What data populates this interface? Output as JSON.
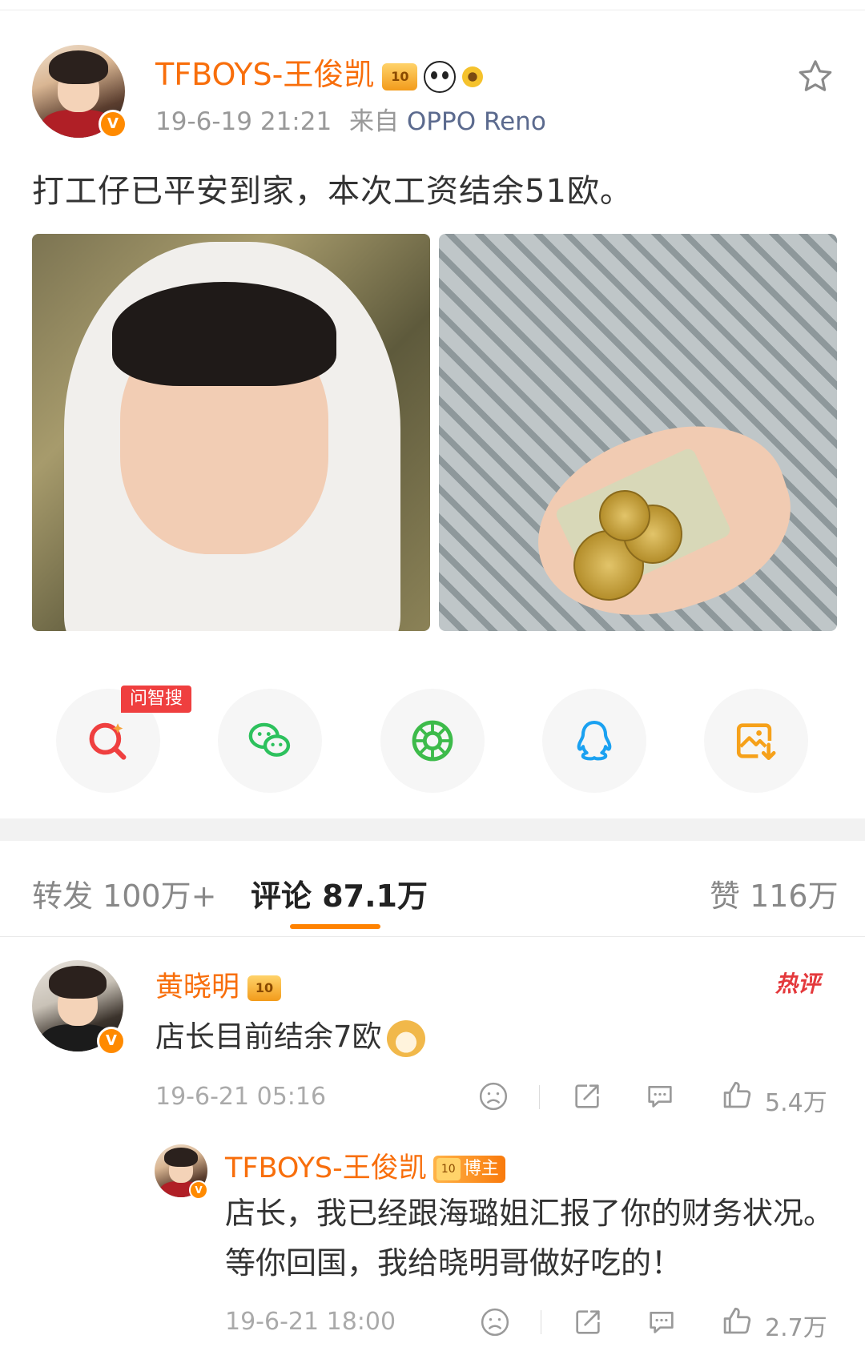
{
  "post": {
    "author": "TFBOYS-王俊凯",
    "crown_badge": "10",
    "timestamp": "19-6-19 21:21",
    "source_prefix": "来自",
    "source_device": "OPPO Reno",
    "text": "打工仔已平安到家，本次工资结余51欧。",
    "verified_mark": "V"
  },
  "share": {
    "tag_label": "问智搜",
    "buttons": [
      "search-ai",
      "wechat",
      "moments",
      "qq",
      "save-image"
    ]
  },
  "tabs": {
    "repost": "转发 100万+",
    "comment": "评论 87.1万",
    "like": "赞 116万"
  },
  "comments": [
    {
      "author": "黄晓明",
      "text": "店长目前结余7欧",
      "time": "19-6-21 05:16",
      "likes": "5.4万",
      "hot_label": "热评",
      "crown_badge": "10",
      "reply": {
        "author": "TFBOYS-王俊凯",
        "badge": "博主",
        "crown_badge": "10",
        "text": "店长，我已经跟海璐姐汇报了你的财务状况。等你回国，我给晓明哥做好吃的！",
        "time": "19-6-21 18:00",
        "likes": "2.7万"
      }
    }
  ],
  "colors": {
    "accent": "#ff8200",
    "username": "#f86e0b",
    "hot": "#e4393c"
  }
}
